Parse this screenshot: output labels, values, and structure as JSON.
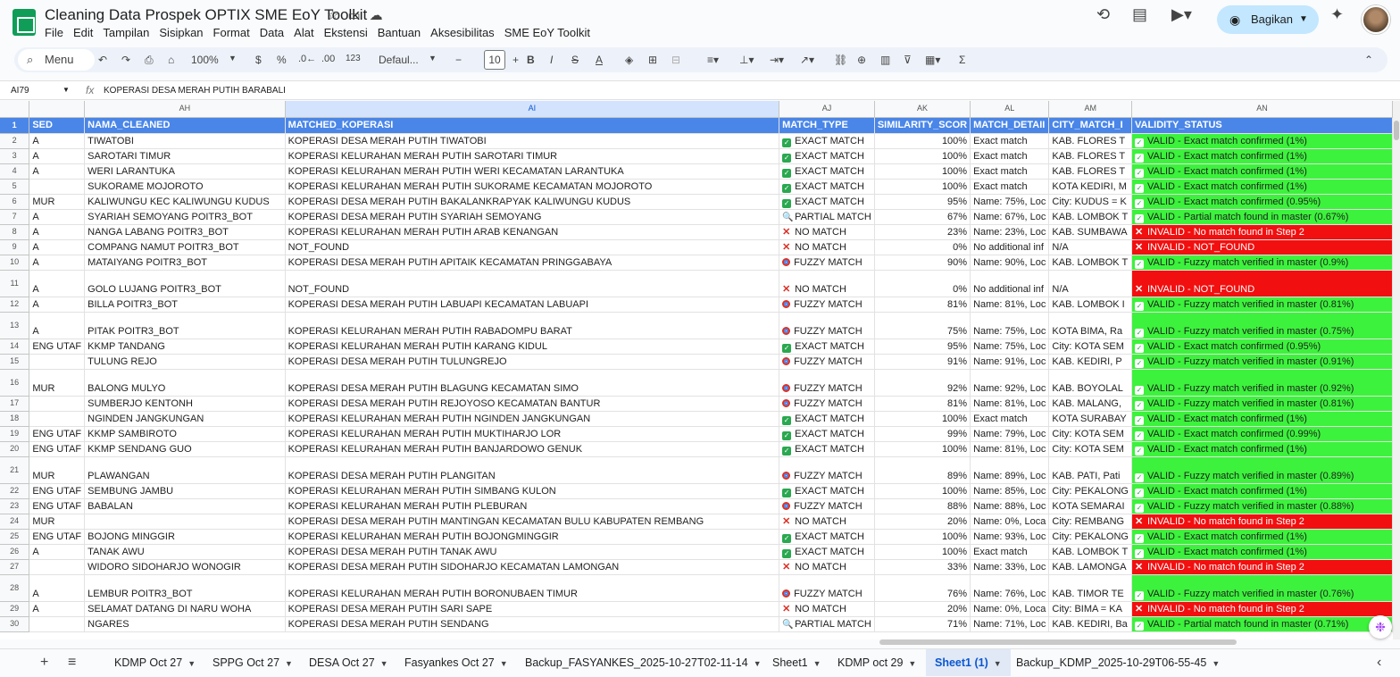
{
  "app": {
    "title": "Cleaning Data Prospek OPTIX SME EoY Toolkit",
    "menus": [
      "File",
      "Edit",
      "Tampilan",
      "Sisipkan",
      "Format",
      "Data",
      "Alat",
      "Ekstensi",
      "Bantuan",
      "Aksesibilitas",
      "SME EoY Toolkit"
    ],
    "share_label": "Bagikan"
  },
  "toolbar": {
    "menu_search": "Menu",
    "zoom": "100%",
    "currency": "$",
    "percent": "%",
    "dec_less": ".0←",
    "dec_more": ".00",
    "number_format": "123",
    "font": "Defaul...",
    "font_size": "10"
  },
  "formula_bar": {
    "cell_ref": "AI79",
    "fx": "fx",
    "content": "KOPERASI DESA MERAH PUTIH BARABALI"
  },
  "columns": [
    "AH",
    "AI",
    "AJ",
    "AK",
    "AL",
    "AM",
    "AN"
  ],
  "headers": [
    "SED",
    "NAMA_CLEANED",
    "MATCHED_KOPERASI",
    "MATCH_TYPE",
    "SIMILARITY_SCOR",
    "MATCH_DETAII",
    "CITY_MATCH_I",
    "VALIDITY_STATUS"
  ],
  "rows": [
    {
      "n": "2",
      "a": "A",
      "b": "TIWATOBI",
      "c": "KOPERASI DESA MERAH PUTIH TIWATOBI",
      "t": "check",
      "d": "EXACT MATCH",
      "e": "100%",
      "f": "Exact match",
      "g": "KAB. FLORES T",
      "v": "VALID - Exact match confirmed (1%)",
      "ok": true
    },
    {
      "n": "3",
      "a": "A",
      "b": "SAROTARI TIMUR",
      "c": "KOPERASI KELURAHAN MERAH PUTIH SAROTARI TIMUR",
      "t": "check",
      "d": "EXACT MATCH",
      "e": "100%",
      "f": "Exact match",
      "g": "KAB. FLORES T",
      "v": "VALID - Exact match confirmed (1%)",
      "ok": true
    },
    {
      "n": "4",
      "a": "A",
      "b": "WERI LARANTUKA",
      "c": "KOPERASI KELURAHAN MERAH PUTIH WERI KECAMATAN LARANTUKA",
      "t": "check",
      "d": "EXACT MATCH",
      "e": "100%",
      "f": "Exact match",
      "g": "KAB. FLORES T",
      "v": "VALID - Exact match confirmed (1%)",
      "ok": true
    },
    {
      "n": "5",
      "a": "",
      "b": "SUKORAME MOJOROTO",
      "c": "KOPERASI KELURAHAN MERAH PUTIH SUKORAME KECAMATAN MOJOROTO",
      "t": "check",
      "d": "EXACT MATCH",
      "e": "100%",
      "f": "Exact match",
      "g": "KOTA KEDIRI, M",
      "v": "VALID - Exact match confirmed (1%)",
      "ok": true
    },
    {
      "n": "6",
      "a": "MUR",
      "b": "KALIWUNGU KEC KALIWUNGU KUDUS",
      "c": "KOPERASI DESA MERAH PUTIH BAKALANKRAPYAK KALIWUNGU KUDUS",
      "t": "check",
      "d": "EXACT MATCH",
      "e": "95%",
      "f": "Name: 75%, Loc",
      "g": "City: KUDUS = K",
      "v": "VALID - Exact match confirmed (0.95%)",
      "ok": true
    },
    {
      "n": "7",
      "a": "A",
      "b": "SYARIAH SEMOYANG POITR3_BOT",
      "c": "KOPERASI DESA MERAH PUTIH SYARIAH SEMOYANG",
      "t": "mag",
      "d": "PARTIAL MATCH",
      "e": "67%",
      "f": "Name: 67%, Loc",
      "g": "KAB. LOMBOK T",
      "v": "VALID - Partial match found in master (0.67%)",
      "ok": true
    },
    {
      "n": "8",
      "a": "A",
      "b": "NANGA LABANG POITR3_BOT",
      "c": "KOPERASI KELURAHAN MERAH PUTIH ARAB KENANGAN",
      "t": "x",
      "d": "NO MATCH",
      "e": "23%",
      "f": "Name: 23%, Loc",
      "g": "KAB. SUMBAWA",
      "v": "INVALID - No match found in Step 2",
      "ok": false
    },
    {
      "n": "9",
      "a": "A",
      "b": "COMPANG NAMUT POITR3_BOT",
      "c": "NOT_FOUND",
      "t": "x",
      "d": "NO MATCH",
      "e": "0%",
      "f": "No additional inf",
      "g": "N/A",
      "v": "INVALID - NOT_FOUND",
      "ok": false
    },
    {
      "n": "10",
      "a": "A",
      "b": "MATAIYANG POITR3_BOT",
      "c": "KOPERASI DESA MERAH PUTIH APITAIK KECAMATAN PRINGGABAYA",
      "t": "target",
      "d": "FUZZY MATCH",
      "e": "90%",
      "f": "Name: 90%, Loc",
      "g": "KAB. LOMBOK T",
      "v": "VALID - Fuzzy match verified in master (0.9%)",
      "ok": true
    },
    {
      "n": "11",
      "a": "A",
      "b": "GOLO LUJANG POITR3_BOT",
      "c": "NOT_FOUND",
      "t": "x",
      "d": "NO MATCH",
      "e": "0%",
      "f": "No additional inf",
      "g": "N/A",
      "v": "INVALID - NOT_FOUND",
      "ok": false,
      "tall": true
    },
    {
      "n": "12",
      "a": "A",
      "b": "BILLA POITR3_BOT",
      "c": "KOPERASI DESA MERAH PUTIH LABUAPI KECAMATAN LABUAPI",
      "t": "target",
      "d": "FUZZY MATCH",
      "e": "81%",
      "f": "Name: 81%, Loc",
      "g": "KAB. LOMBOK I",
      "v": "VALID - Fuzzy match verified in master (0.81%)",
      "ok": true
    },
    {
      "n": "13",
      "a": "A",
      "b": "PITAK POITR3_BOT",
      "c": "KOPERASI KELURAHAN MERAH PUTIH RABADOMPU BARAT",
      "t": "target",
      "d": "FUZZY MATCH",
      "e": "75%",
      "f": "Name: 75%, Loc",
      "g": "KOTA BIMA, Ra",
      "v": "VALID - Fuzzy match verified in master (0.75%)",
      "ok": true,
      "tall": true
    },
    {
      "n": "14",
      "a": "ENG UTAF",
      "b": "KKMP TANDANG",
      "c": "KOPERASI KELURAHAN MERAH PUTIH KARANG KIDUL",
      "t": "check",
      "d": "EXACT MATCH",
      "e": "95%",
      "f": "Name: 75%, Loc",
      "g": "City: KOTA SEM",
      "v": "VALID - Exact match confirmed (0.95%)",
      "ok": true
    },
    {
      "n": "15",
      "a": "",
      "b": "TULUNG REJO",
      "c": "KOPERASI DESA MERAH PUTIH TULUNGREJO",
      "t": "target",
      "d": "FUZZY MATCH",
      "e": "91%",
      "f": "Name: 91%, Loc",
      "g": "KAB. KEDIRI, P",
      "v": "VALID - Fuzzy match verified in master (0.91%)",
      "ok": true
    },
    {
      "n": "16",
      "a": "MUR",
      "b": "BALONG MULYO",
      "c": "KOPERASI DESA MERAH PUTIH BLAGUNG KECAMATAN SIMO",
      "t": "target",
      "d": "FUZZY MATCH",
      "e": "92%",
      "f": "Name: 92%, Loc",
      "g": "KAB. BOYOLAL",
      "v": "VALID - Fuzzy match verified in master (0.92%)",
      "ok": true,
      "tall": true
    },
    {
      "n": "17",
      "a": "",
      "b": "SUMBERJO KENTONH",
      "c": "KOPERASI DESA MERAH PUTIH REJOYOSO KECAMATAN BANTUR",
      "t": "target",
      "d": "FUZZY MATCH",
      "e": "81%",
      "f": "Name: 81%, Loc",
      "g": "KAB. MALANG,",
      "v": "VALID - Fuzzy match verified in master (0.81%)",
      "ok": true
    },
    {
      "n": "18",
      "a": "",
      "b": "NGINDEN JANGKUNGAN",
      "c": "KOPERASI KELURAHAN MERAH PUTIH NGINDEN JANGKUNGAN",
      "t": "check",
      "d": "EXACT MATCH",
      "e": "100%",
      "f": "Exact match",
      "g": "KOTA SURABAY",
      "v": "VALID - Exact match confirmed (1%)",
      "ok": true
    },
    {
      "n": "19",
      "a": "ENG UTAF",
      "b": "KKMP SAMBIROTO",
      "c": "KOPERASI KELURAHAN MERAH PUTIH MUKTIHARJO LOR",
      "t": "check",
      "d": "EXACT MATCH",
      "e": "99%",
      "f": "Name: 79%, Loc",
      "g": "City: KOTA SEM",
      "v": "VALID - Exact match confirmed (0.99%)",
      "ok": true
    },
    {
      "n": "20",
      "a": "ENG UTAF",
      "b": "KKMP SENDANG GUO",
      "c": "KOPERASI KELURAHAN MERAH PUTIH BANJARDOWO GENUK",
      "t": "check",
      "d": "EXACT MATCH",
      "e": "100%",
      "f": "Name: 81%, Loc",
      "g": "City: KOTA SEM",
      "v": "VALID - Exact match confirmed (1%)",
      "ok": true
    },
    {
      "n": "21",
      "a": "MUR",
      "b": "PLAWANGAN",
      "c": "KOPERASI DESA MERAH PUTIH PLANGITAN",
      "t": "target",
      "d": "FUZZY MATCH",
      "e": "89%",
      "f": "Name: 89%, Loc",
      "g": "KAB. PATI, Pati",
      "v": "VALID - Fuzzy match verified in master (0.89%)",
      "ok": true,
      "tall": true
    },
    {
      "n": "22",
      "a": "ENG UTAF",
      "b": "SEMBUNG JAMBU",
      "c": "KOPERASI KELURAHAN MERAH PUTIH SIMBANG KULON",
      "t": "check",
      "d": "EXACT MATCH",
      "e": "100%",
      "f": "Name: 85%, Loc",
      "g": "City: PEKALONG",
      "v": "VALID - Exact match confirmed (1%)",
      "ok": true
    },
    {
      "n": "23",
      "a": "ENG UTAF",
      "b": "BABALAN",
      "c": "KOPERASI KELURAHAN MERAH PUTIH PLEBURAN",
      "t": "target",
      "d": "FUZZY MATCH",
      "e": "88%",
      "f": "Name: 88%, Loc",
      "g": "KOTA SEMARAI",
      "v": "VALID - Fuzzy match verified in master (0.88%)",
      "ok": true
    },
    {
      "n": "24",
      "a": "MUR",
      "b": "",
      "c": "KOPERASI DESA MERAH PUTIH MANTINGAN KECAMATAN BULU KABUPATEN REMBANG",
      "t": "x",
      "d": "NO MATCH",
      "e": "20%",
      "f": "Name: 0%, Loca",
      "g": "City: REMBANG",
      "v": "INVALID - No match found in Step 2",
      "ok": false
    },
    {
      "n": "25",
      "a": "ENG UTAF",
      "b": "BOJONG MINGGIR",
      "c": "KOPERASI KELURAHAN MERAH PUTIH BOJONGMINGGIR",
      "t": "check",
      "d": "EXACT MATCH",
      "e": "100%",
      "f": "Name: 93%, Loc",
      "g": "City: PEKALONG",
      "v": "VALID - Exact match confirmed (1%)",
      "ok": true
    },
    {
      "n": "26",
      "a": "A",
      "b": "TANAK AWU",
      "c": "KOPERASI DESA MERAH PUTIH TANAK AWU",
      "t": "check",
      "d": "EXACT MATCH",
      "e": "100%",
      "f": "Exact match",
      "g": "KAB. LOMBOK T",
      "v": "VALID - Exact match confirmed (1%)",
      "ok": true
    },
    {
      "n": "27",
      "a": "",
      "b": "WIDORO SIDOHARJO WONOGIR",
      "c": "KOPERASI DESA MERAH PUTIH SIDOHARJO KECAMATAN LAMONGAN",
      "t": "x",
      "d": "NO MATCH",
      "e": "33%",
      "f": "Name: 33%, Loc",
      "g": "KAB. LAMONGA",
      "v": "INVALID - No match found in Step 2",
      "ok": false
    },
    {
      "n": "28",
      "a": "A",
      "b": "LEMBUR POITR3_BOT",
      "c": "KOPERASI KELURAHAN MERAH PUTIH BORONUBAEN TIMUR",
      "t": "target",
      "d": "FUZZY MATCH",
      "e": "76%",
      "f": "Name: 76%, Loc",
      "g": "KAB. TIMOR TE",
      "v": "VALID - Fuzzy match verified in master (0.76%)",
      "ok": true,
      "tall": true
    },
    {
      "n": "29",
      "a": "A",
      "b": "SELAMAT DATANG DI NARU WOHA",
      "c": "KOPERASI DESA MERAH PUTIH SARI SAPE",
      "t": "x",
      "d": "NO MATCH",
      "e": "20%",
      "f": "Name: 0%, Loca",
      "g": "City: BIMA = KA",
      "v": "INVALID - No match found in Step 2",
      "ok": false
    },
    {
      "n": "30",
      "a": "",
      "b": "NGARES",
      "c": "KOPERASI DESA MERAH PUTIH SENDANG",
      "t": "mag",
      "d": "PARTIAL MATCH",
      "e": "71%",
      "f": "Name: 71%, Loc",
      "g": "KAB. KEDIRI, Ba",
      "v": "VALID - Partial match found in master (0.71%)",
      "ok": true
    }
  ],
  "sheets": [
    {
      "label": "KDMP Oct 27"
    },
    {
      "label": "SPPG Oct 27"
    },
    {
      "label": "DESA Oct 27"
    },
    {
      "label": "Fasyankes Oct 27"
    },
    {
      "label": "Backup_FASYANKES_2025-10-27T02-11-14"
    },
    {
      "label": "Sheet1"
    },
    {
      "label": "KDMP oct 29"
    },
    {
      "label": "Sheet1 (1)",
      "active": true
    },
    {
      "label": "Backup_KDMP_2025-10-29T06-55-45"
    }
  ]
}
